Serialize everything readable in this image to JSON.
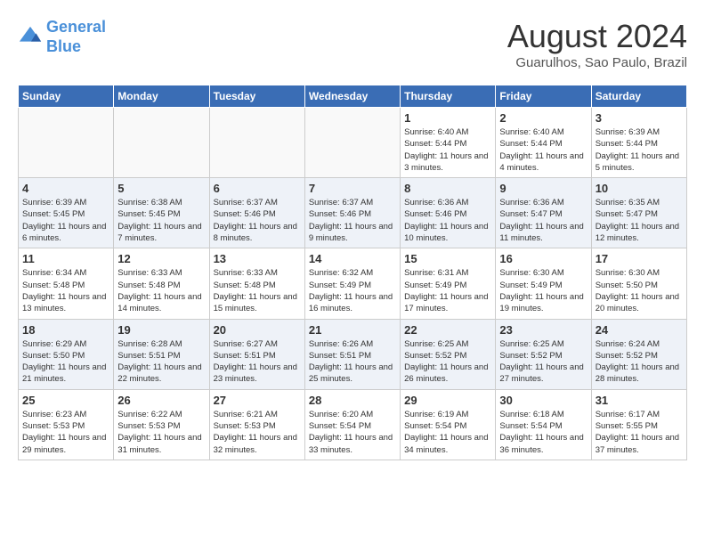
{
  "header": {
    "logo_line1": "General",
    "logo_line2": "Blue",
    "month": "August 2024",
    "location": "Guarulhos, Sao Paulo, Brazil"
  },
  "weekdays": [
    "Sunday",
    "Monday",
    "Tuesday",
    "Wednesday",
    "Thursday",
    "Friday",
    "Saturday"
  ],
  "weeks": [
    [
      {
        "day": "",
        "info": ""
      },
      {
        "day": "",
        "info": ""
      },
      {
        "day": "",
        "info": ""
      },
      {
        "day": "",
        "info": ""
      },
      {
        "day": "1",
        "info": "Sunrise: 6:40 AM\nSunset: 5:44 PM\nDaylight: 11 hours and 3 minutes."
      },
      {
        "day": "2",
        "info": "Sunrise: 6:40 AM\nSunset: 5:44 PM\nDaylight: 11 hours and 4 minutes."
      },
      {
        "day": "3",
        "info": "Sunrise: 6:39 AM\nSunset: 5:44 PM\nDaylight: 11 hours and 5 minutes."
      }
    ],
    [
      {
        "day": "4",
        "info": "Sunrise: 6:39 AM\nSunset: 5:45 PM\nDaylight: 11 hours and 6 minutes."
      },
      {
        "day": "5",
        "info": "Sunrise: 6:38 AM\nSunset: 5:45 PM\nDaylight: 11 hours and 7 minutes."
      },
      {
        "day": "6",
        "info": "Sunrise: 6:37 AM\nSunset: 5:46 PM\nDaylight: 11 hours and 8 minutes."
      },
      {
        "day": "7",
        "info": "Sunrise: 6:37 AM\nSunset: 5:46 PM\nDaylight: 11 hours and 9 minutes."
      },
      {
        "day": "8",
        "info": "Sunrise: 6:36 AM\nSunset: 5:46 PM\nDaylight: 11 hours and 10 minutes."
      },
      {
        "day": "9",
        "info": "Sunrise: 6:36 AM\nSunset: 5:47 PM\nDaylight: 11 hours and 11 minutes."
      },
      {
        "day": "10",
        "info": "Sunrise: 6:35 AM\nSunset: 5:47 PM\nDaylight: 11 hours and 12 minutes."
      }
    ],
    [
      {
        "day": "11",
        "info": "Sunrise: 6:34 AM\nSunset: 5:48 PM\nDaylight: 11 hours and 13 minutes."
      },
      {
        "day": "12",
        "info": "Sunrise: 6:33 AM\nSunset: 5:48 PM\nDaylight: 11 hours and 14 minutes."
      },
      {
        "day": "13",
        "info": "Sunrise: 6:33 AM\nSunset: 5:48 PM\nDaylight: 11 hours and 15 minutes."
      },
      {
        "day": "14",
        "info": "Sunrise: 6:32 AM\nSunset: 5:49 PM\nDaylight: 11 hours and 16 minutes."
      },
      {
        "day": "15",
        "info": "Sunrise: 6:31 AM\nSunset: 5:49 PM\nDaylight: 11 hours and 17 minutes."
      },
      {
        "day": "16",
        "info": "Sunrise: 6:30 AM\nSunset: 5:49 PM\nDaylight: 11 hours and 19 minutes."
      },
      {
        "day": "17",
        "info": "Sunrise: 6:30 AM\nSunset: 5:50 PM\nDaylight: 11 hours and 20 minutes."
      }
    ],
    [
      {
        "day": "18",
        "info": "Sunrise: 6:29 AM\nSunset: 5:50 PM\nDaylight: 11 hours and 21 minutes."
      },
      {
        "day": "19",
        "info": "Sunrise: 6:28 AM\nSunset: 5:51 PM\nDaylight: 11 hours and 22 minutes."
      },
      {
        "day": "20",
        "info": "Sunrise: 6:27 AM\nSunset: 5:51 PM\nDaylight: 11 hours and 23 minutes."
      },
      {
        "day": "21",
        "info": "Sunrise: 6:26 AM\nSunset: 5:51 PM\nDaylight: 11 hours and 25 minutes."
      },
      {
        "day": "22",
        "info": "Sunrise: 6:25 AM\nSunset: 5:52 PM\nDaylight: 11 hours and 26 minutes."
      },
      {
        "day": "23",
        "info": "Sunrise: 6:25 AM\nSunset: 5:52 PM\nDaylight: 11 hours and 27 minutes."
      },
      {
        "day": "24",
        "info": "Sunrise: 6:24 AM\nSunset: 5:52 PM\nDaylight: 11 hours and 28 minutes."
      }
    ],
    [
      {
        "day": "25",
        "info": "Sunrise: 6:23 AM\nSunset: 5:53 PM\nDaylight: 11 hours and 29 minutes."
      },
      {
        "day": "26",
        "info": "Sunrise: 6:22 AM\nSunset: 5:53 PM\nDaylight: 11 hours and 31 minutes."
      },
      {
        "day": "27",
        "info": "Sunrise: 6:21 AM\nSunset: 5:53 PM\nDaylight: 11 hours and 32 minutes."
      },
      {
        "day": "28",
        "info": "Sunrise: 6:20 AM\nSunset: 5:54 PM\nDaylight: 11 hours and 33 minutes."
      },
      {
        "day": "29",
        "info": "Sunrise: 6:19 AM\nSunset: 5:54 PM\nDaylight: 11 hours and 34 minutes."
      },
      {
        "day": "30",
        "info": "Sunrise: 6:18 AM\nSunset: 5:54 PM\nDaylight: 11 hours and 36 minutes."
      },
      {
        "day": "31",
        "info": "Sunrise: 6:17 AM\nSunset: 5:55 PM\nDaylight: 11 hours and 37 minutes."
      }
    ]
  ]
}
